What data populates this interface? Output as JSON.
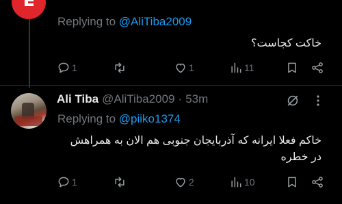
{
  "tweet1": {
    "replying_prefix": "Replying to ",
    "replying_handle": "@AliTiba2009",
    "text": "خاکت کجاست؟",
    "stats": {
      "replies": "1",
      "retweets": "",
      "likes": "1",
      "views": "11"
    }
  },
  "tweet2": {
    "name": "Ali Tiba",
    "handle": "@AliTiba2009",
    "sep": "·",
    "time": "53m",
    "replying_prefix": "Replying to ",
    "replying_handle": "@piiko1374",
    "text_line1": "خاکم فعلا ایرانه که آذربایجان جنوبی هم الان به همراهش",
    "text_line2": "در خطره",
    "stats": {
      "replies": "1",
      "retweets": "",
      "likes": "2",
      "views": "10"
    }
  },
  "icons": [
    "reply-icon",
    "retweet-icon",
    "like-icon",
    "views-icon",
    "bookmark-icon",
    "share-icon",
    "block-icon",
    "more-icon"
  ]
}
